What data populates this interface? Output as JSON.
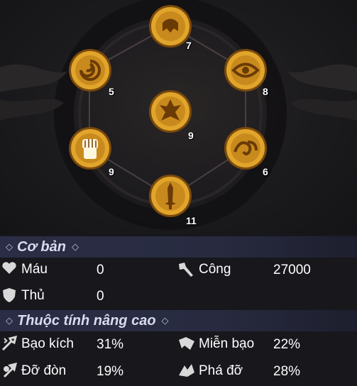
{
  "wheel": {
    "nodes": [
      {
        "name": "top",
        "icon": "helmet-emblem-icon",
        "level": "7"
      },
      {
        "name": "upper-left",
        "icon": "swirl-emblem-icon",
        "level": "5"
      },
      {
        "name": "upper-right",
        "icon": "eye-emblem-icon",
        "level": "8"
      },
      {
        "name": "center",
        "icon": "warrior-emblem-icon",
        "level": "9"
      },
      {
        "name": "lower-left",
        "icon": "fist-emblem-icon",
        "level": "9"
      },
      {
        "name": "lower-right",
        "icon": "wave-emblem-icon",
        "level": "6"
      },
      {
        "name": "bottom",
        "icon": "sword-emblem-icon",
        "level": "11"
      }
    ]
  },
  "basic": {
    "title": "Cơ bản",
    "hp_label": "Máu",
    "hp_value": "0",
    "atk_label": "Công",
    "atk_value": "27000",
    "def_label": "Thủ",
    "def_value": "0"
  },
  "advanced": {
    "title": "Thuộc tính nâng cao",
    "crit_label": "Bạo kích",
    "crit_value": "31%",
    "crit_res_label": "Miễn bạo",
    "crit_res_value": "22%",
    "block_label": "Đỡ đòn",
    "block_value": "19%",
    "block_break_label": "Phá đỡ",
    "block_break_value": "28%"
  },
  "colors": {
    "gold": "#e1a52c",
    "gold_dark": "#7a4a0c",
    "section_bar": "#2a2d45",
    "icon_gray": "#d8d8d8"
  }
}
